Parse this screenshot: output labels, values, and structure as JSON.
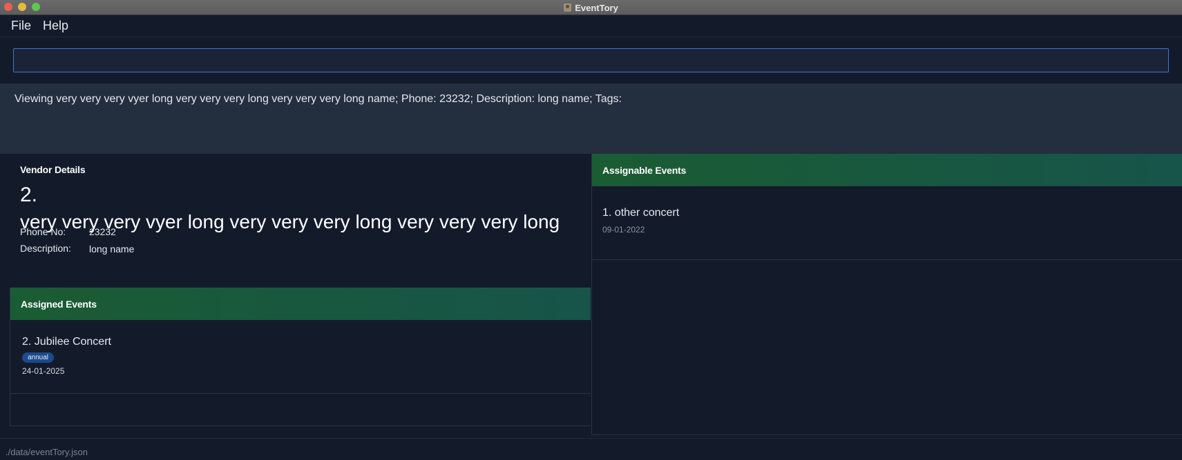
{
  "window": {
    "title": "EventTory"
  },
  "menu": {
    "file": "File",
    "help": "Help"
  },
  "command": {
    "value": "",
    "placeholder": ""
  },
  "result": {
    "message": "Viewing very very very vyer long very very very long very very very long name; Phone: 23232; Description: long name; Tags:"
  },
  "vendor_details": {
    "heading": "Vendor Details",
    "index": "2.",
    "name": "very very very vyer long very very very long very very very long",
    "phone_label": "Phone No:",
    "phone_value": "23232",
    "description_label": "Description:",
    "description_value": "long name"
  },
  "assigned_events": {
    "heading": "Assigned Events",
    "items": [
      {
        "name": "2. Jubilee Concert",
        "tag": "annual",
        "date": "24-01-2025"
      }
    ]
  },
  "assignable_events": {
    "heading": "Assignable Events",
    "items": [
      {
        "name": "1. other concert",
        "date": "09-01-2022"
      }
    ]
  },
  "status": {
    "path": "./data/eventTory.json"
  },
  "colors": {
    "accent_green": "#1a5c33",
    "accent_teal": "#17544a",
    "tag_blue": "#1c4a8a",
    "focus_blue": "#3c79d4"
  }
}
